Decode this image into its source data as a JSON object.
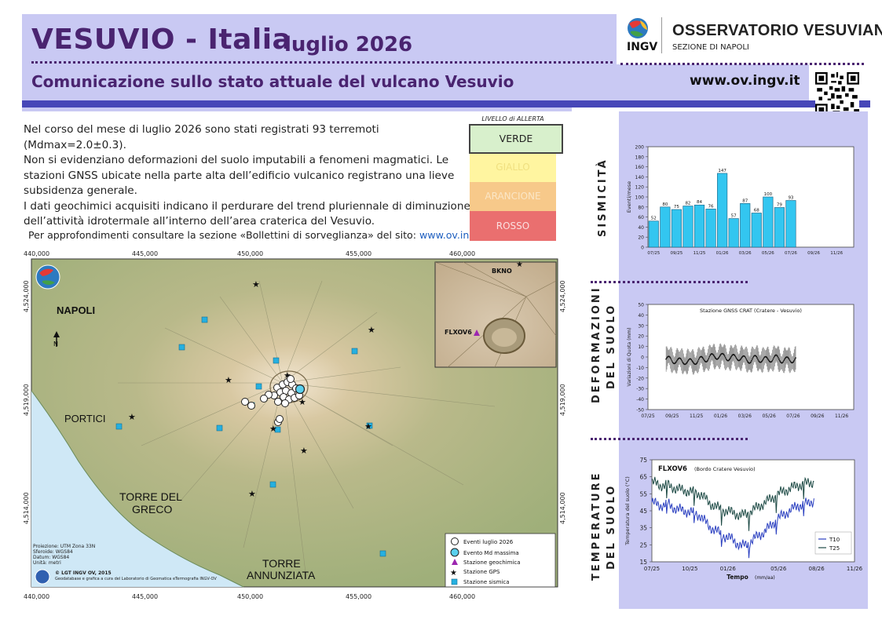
{
  "header": {
    "title": "VESUVIO  -  Italia",
    "date": "luglio 2026",
    "subtitle": "Comunicazione sullo stato attuale del vulcano Vesuvio",
    "website": "www.ov.ingv.it",
    "logo_ingv": "INGV",
    "org_name": "OSSERVATORIO VESUVIANO",
    "org_section": "SEZIONE DI NAPOLI"
  },
  "description": {
    "lines": [
      "Nel corso del mese di luglio 2026 sono stati registrati 93 terremoti",
      "(Mdmax=2.0±0.3).",
      "Non si evidenziano deformazioni del suolo imputabili a fenomeni magmatici. Le",
      "stazioni GNSS ubicate nella parte alta dell’edificio vulcanico registrano una lieve",
      "subsidenza generale.",
      "I dati geochimici acquisiti indicano il perdurare del trend pluriennale di diminuzione",
      "dell’attività idrotermale all’interno dell’area craterica del Vesuvio."
    ],
    "link_prefix": "Per approfondimenti consultare la sezione «Bollettini di sorveglianza» del sito: ",
    "link_text": "www.ov.ingv.it"
  },
  "alert": {
    "title": "LIVELLO di ALLERTA",
    "levels": [
      "VERDE",
      "GIALLO",
      "ARANCIONE",
      "ROSSO"
    ],
    "current": "VERDE"
  },
  "colors": {
    "header_purple": "#4a2470",
    "header_band": "#c9c9f3",
    "stripe_blue": "#4747b8",
    "bar_cyan": "#33c6f0",
    "t10": "#2a3fc0",
    "t25": "#1d4a45"
  },
  "map": {
    "x_ticks": [
      "440,000",
      "445,000",
      "450,000",
      "455,000",
      "460,000"
    ],
    "y_ticks": [
      "4,524,000",
      "4,519,000",
      "4,514,000"
    ],
    "places": [
      "NAPOLI",
      "PORTICI",
      "TORRE DEL",
      "GRECO",
      "TORRE",
      "ANNUNZIATA"
    ],
    "north": "N",
    "inset_labels": [
      "BKNO",
      "FLXOV6"
    ],
    "projection": [
      "Proiezione: UTM Zona 33N",
      "Sferoide: WGS84",
      "Datum: WGS84",
      "Unità: metri"
    ],
    "credit": "© LGT INGV OV, 2015",
    "credit_sub": "Geodatabase e grafica a cura del Laboratorio di Geomatica eTermografia INGV-OV",
    "legend": [
      "Eventi luglio 2026",
      "Evento Md massima",
      "Stazione geochimica",
      "Stazione GPS",
      "Stazione sismica"
    ]
  },
  "sections": {
    "seismicity": "SISMICITÀ",
    "deformation_1": "DEFORMAZIONI",
    "deformation_2": "DEL SUOLO",
    "temperature_1": "TEMPERATURE",
    "temperature_2": "DEL SUOLO"
  },
  "chart_data": [
    {
      "type": "bar",
      "title": "",
      "ylabel": "Eventi/mese",
      "ylim": [
        0,
        200
      ],
      "yticks": [
        0,
        20,
        40,
        60,
        80,
        100,
        120,
        140,
        160,
        180,
        200
      ],
      "categories": [
        "07/25",
        "08/25",
        "09/25",
        "10/25",
        "11/25",
        "12/25",
        "01/26",
        "02/26",
        "03/26",
        "04/26",
        "05/26",
        "06/26",
        "07/26",
        "08/26",
        "09/26",
        "10/26",
        "11/26",
        "12/26"
      ],
      "values": [
        52,
        80,
        75,
        82,
        84,
        76,
        147,
        57,
        87,
        68,
        100,
        79,
        93,
        null,
        null,
        null,
        null,
        null
      ],
      "xtick_labels": [
        "07/25",
        "09/25",
        "11/25",
        "01/26",
        "03/26",
        "05/26",
        "07/26",
        "09/26",
        "11/26"
      ],
      "grid": false
    },
    {
      "type": "scatter",
      "title": "Stazione GNSS CRAT (Cratere - Vesuvio)",
      "ylabel": "Variazioni di Quota (mm)",
      "ylim": [
        -50,
        50
      ],
      "yticks": [
        -50,
        -40,
        -30,
        -20,
        -10,
        0,
        10,
        20,
        30,
        40,
        50
      ],
      "xtick_labels": [
        "07/25",
        "09/25",
        "11/25",
        "01/26",
        "03/26",
        "05/26",
        "07/26",
        "09/26",
        "11/26"
      ],
      "data_start_month": 1.5,
      "data_end_month": 12.2,
      "mean_values": [
        -2,
        -3,
        -4,
        -4,
        -5,
        -3,
        -2,
        0,
        1,
        0,
        -1,
        0,
        -2,
        -3,
        -1,
        -3,
        -2,
        -1,
        -3,
        -3,
        -2
      ],
      "error_bar_halfwidth": 9,
      "grid": false
    },
    {
      "type": "line",
      "title": "FLXOV6",
      "subtitle": "(Bordo Cratere Vesuvio)",
      "xlabel": "Tempo",
      "xlabel_unit": "(mm/aa)",
      "ylabel": "Temperatura del suolo (°C)",
      "ylim": [
        15,
        75
      ],
      "yticks": [
        15,
        25,
        35,
        45,
        55,
        65,
        75
      ],
      "xtick_labels": [
        "07/25",
        "10/25",
        "01/26",
        "05/26",
        "08/26",
        "11/26"
      ],
      "series": [
        {
          "name": "T10",
          "values": [
            50,
            48,
            49,
            46,
            45,
            44,
            42,
            36,
            33,
            30,
            28,
            24,
            26,
            30,
            33,
            38,
            42,
            45,
            48,
            49,
            51
          ]
        },
        {
          "name": "T25",
          "values": [
            62,
            60,
            60,
            58,
            57,
            56,
            55,
            50,
            47,
            45,
            44,
            42,
            44,
            47,
            50,
            53,
            56,
            58,
            60,
            61,
            62
          ]
        }
      ],
      "grid": false
    }
  ]
}
